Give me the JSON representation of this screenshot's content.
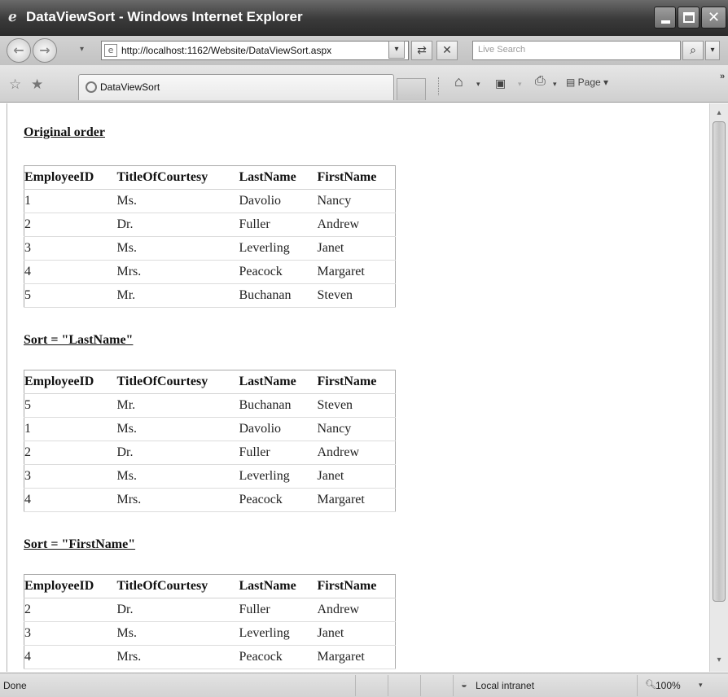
{
  "window": {
    "title": "DataViewSort - Windows Internet Explorer"
  },
  "address_bar": {
    "url": "http://localhost:1162/Website/DataViewSort.aspx"
  },
  "search": {
    "placeholder": "Live Search"
  },
  "tab": {
    "title": "DataViewSort"
  },
  "command_bar": {
    "page_label": "Page"
  },
  "sections": [
    {
      "title": "Original order",
      "headers": [
        "EmployeeID",
        "TitleOfCourtesy",
        "LastName",
        "FirstName"
      ],
      "rows": [
        [
          "1",
          "Ms.",
          "Davolio",
          "Nancy"
        ],
        [
          "2",
          "Dr.",
          "Fuller",
          "Andrew"
        ],
        [
          "3",
          "Ms.",
          "Leverling",
          "Janet"
        ],
        [
          "4",
          "Mrs.",
          "Peacock",
          "Margaret"
        ],
        [
          "5",
          "Mr.",
          "Buchanan",
          "Steven"
        ]
      ]
    },
    {
      "title": "Sort = \"LastName\"",
      "headers": [
        "EmployeeID",
        "TitleOfCourtesy",
        "LastName",
        "FirstName"
      ],
      "rows": [
        [
          "5",
          "Mr.",
          "Buchanan",
          "Steven"
        ],
        [
          "1",
          "Ms.",
          "Davolio",
          "Nancy"
        ],
        [
          "2",
          "Dr.",
          "Fuller",
          "Andrew"
        ],
        [
          "3",
          "Ms.",
          "Leverling",
          "Janet"
        ],
        [
          "4",
          "Mrs.",
          "Peacock",
          "Margaret"
        ]
      ]
    },
    {
      "title": "Sort = \"FirstName\"",
      "headers": [
        "EmployeeID",
        "TitleOfCourtesy",
        "LastName",
        "FirstName"
      ],
      "rows": [
        [
          "2",
          "Dr.",
          "Fuller",
          "Andrew"
        ],
        [
          "3",
          "Ms.",
          "Leverling",
          "Janet"
        ],
        [
          "4",
          "Mrs.",
          "Peacock",
          "Margaret"
        ]
      ]
    }
  ],
  "status_bar": {
    "status": "Done",
    "zone": "Local intranet",
    "zoom": "100%"
  }
}
